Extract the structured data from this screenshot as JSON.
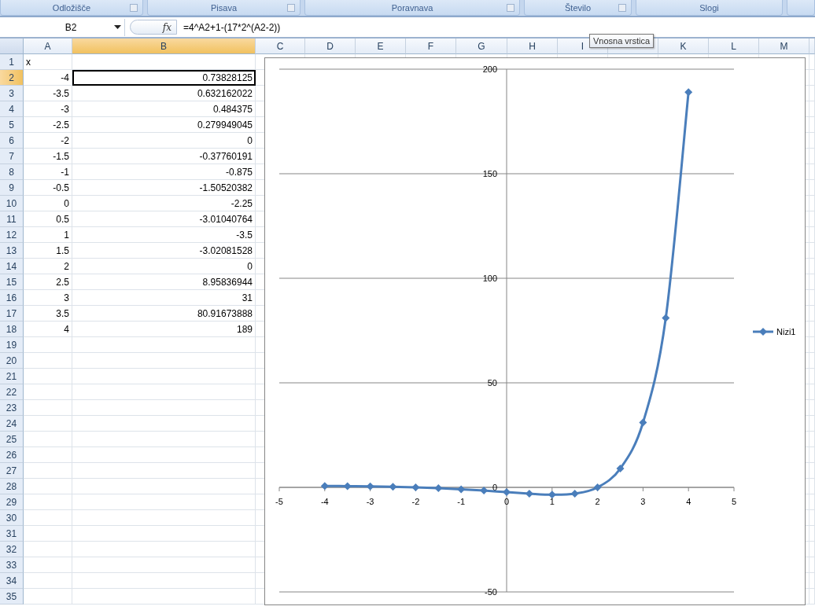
{
  "ribbon_groups": [
    {
      "label": "Odložišče",
      "launcher": true
    },
    {
      "label": "Pisava",
      "launcher": true
    },
    {
      "label": "Poravnava",
      "launcher": true
    },
    {
      "label": "Število",
      "launcher": true
    },
    {
      "label": "Slogi",
      "launcher": false
    }
  ],
  "formula_bar": {
    "name_box": "B2",
    "function_button": "fx",
    "formula": "=4^A2+1-(17*2^(A2-2))"
  },
  "tooltip": "Vnosna vrstica",
  "columns": [
    {
      "label": "A"
    },
    {
      "label": "B"
    },
    {
      "label": "C"
    },
    {
      "label": "D"
    },
    {
      "label": "E"
    },
    {
      "label": "F"
    },
    {
      "label": "G"
    },
    {
      "label": "H"
    },
    {
      "label": "I"
    },
    {},
    {
      "label": "K"
    },
    {
      "label": "L"
    },
    {
      "label": "M"
    }
  ],
  "rows": [
    {
      "header": "1",
      "cells": [
        {
          "text": "x",
          "kind": "text",
          "selected": false
        },
        {
          "selected": false
        }
      ]
    },
    {
      "header": "2",
      "cells": [
        {
          "text": "-4",
          "kind": "number",
          "selected": false
        },
        {
          "text": "0.73828125",
          "kind": "number",
          "selected": true
        }
      ]
    },
    {
      "header": "3",
      "cells": [
        {
          "text": "-3.5",
          "kind": "number",
          "selected": false
        },
        {
          "text": "0.632162022",
          "kind": "number",
          "selected": false
        }
      ]
    },
    {
      "header": "4",
      "cells": [
        {
          "text": "-3",
          "kind": "number",
          "selected": false
        },
        {
          "text": "0.484375",
          "kind": "number",
          "selected": false
        }
      ]
    },
    {
      "header": "5",
      "cells": [
        {
          "text": "-2.5",
          "kind": "number",
          "selected": false
        },
        {
          "text": "0.279949045",
          "kind": "number",
          "selected": false
        }
      ]
    },
    {
      "header": "6",
      "cells": [
        {
          "text": "-2",
          "kind": "number",
          "selected": false
        },
        {
          "text": "0",
          "kind": "number",
          "selected": false
        }
      ]
    },
    {
      "header": "7",
      "cells": [
        {
          "text": "-1.5",
          "kind": "number",
          "selected": false
        },
        {
          "text": "-0.37760191",
          "kind": "number",
          "selected": false
        }
      ]
    },
    {
      "header": "8",
      "cells": [
        {
          "text": "-1",
          "kind": "number",
          "selected": false
        },
        {
          "text": "-0.875",
          "kind": "number",
          "selected": false
        }
      ]
    },
    {
      "header": "9",
      "cells": [
        {
          "text": "-0.5",
          "kind": "number",
          "selected": false
        },
        {
          "text": "-1.50520382",
          "kind": "number",
          "selected": false
        }
      ]
    },
    {
      "header": "10",
      "cells": [
        {
          "text": "0",
          "kind": "number",
          "selected": false
        },
        {
          "text": "-2.25",
          "kind": "number",
          "selected": false
        }
      ]
    },
    {
      "header": "11",
      "cells": [
        {
          "text": "0.5",
          "kind": "number",
          "selected": false
        },
        {
          "text": "-3.01040764",
          "kind": "number",
          "selected": false
        }
      ]
    },
    {
      "header": "12",
      "cells": [
        {
          "text": "1",
          "kind": "number",
          "selected": false
        },
        {
          "text": "-3.5",
          "kind": "number",
          "selected": false
        }
      ]
    },
    {
      "header": "13",
      "cells": [
        {
          "text": "1.5",
          "kind": "number",
          "selected": false
        },
        {
          "text": "-3.02081528",
          "kind": "number",
          "selected": false
        }
      ]
    },
    {
      "header": "14",
      "cells": [
        {
          "text": "2",
          "kind": "number",
          "selected": false
        },
        {
          "text": "0",
          "kind": "number",
          "selected": false
        }
      ]
    },
    {
      "header": "15",
      "cells": [
        {
          "text": "2.5",
          "kind": "number",
          "selected": false
        },
        {
          "text": "8.95836944",
          "kind": "number",
          "selected": false
        }
      ]
    },
    {
      "header": "16",
      "cells": [
        {
          "text": "3",
          "kind": "number",
          "selected": false
        },
        {
          "text": "31",
          "kind": "number",
          "selected": false
        }
      ]
    },
    {
      "header": "17",
      "cells": [
        {
          "text": "3.5",
          "kind": "number",
          "selected": false
        },
        {
          "text": "80.91673888",
          "kind": "number",
          "selected": false
        }
      ]
    },
    {
      "header": "18",
      "cells": [
        {
          "text": "4",
          "kind": "number",
          "selected": false
        },
        {
          "text": "189",
          "kind": "number",
          "selected": false
        }
      ]
    },
    {
      "header": "19"
    },
    {
      "header": "20"
    },
    {
      "header": "21"
    },
    {
      "header": "22"
    },
    {
      "header": "23"
    },
    {
      "header": "24"
    },
    {
      "header": "25"
    },
    {
      "header": "26"
    },
    {
      "header": "27"
    },
    {
      "header": "28"
    },
    {
      "header": "29"
    },
    {
      "header": "30"
    },
    {
      "header": "31"
    },
    {
      "header": "32"
    },
    {
      "header": "33"
    },
    {
      "header": "34"
    },
    {
      "header": "35"
    }
  ],
  "chart": {
    "chart_data": {
      "type": "line",
      "x": [
        -4,
        -3.5,
        -3,
        -2.5,
        -2,
        -1.5,
        -1,
        -0.5,
        0,
        0.5,
        1,
        1.5,
        2,
        2.5,
        3,
        3.5,
        4
      ],
      "series": [
        {
          "name": "Nizi1",
          "color": "#4a7ebb",
          "marker": "diamond",
          "values": [
            0.7,
            0.6,
            0.5,
            0.3,
            0,
            -0.4,
            -0.9,
            -1.5,
            -2.3,
            -3,
            -3.5,
            -3,
            0,
            9,
            31,
            81,
            189
          ]
        }
      ],
      "grid": true,
      "xlim": [
        -5,
        5
      ],
      "ylim": [
        -50,
        200
      ],
      "xticks": [
        -5,
        -4,
        -3,
        -2,
        -1,
        0,
        1,
        2,
        3,
        4,
        5
      ],
      "yticks": [
        -50,
        0,
        50,
        100,
        150,
        200
      ]
    }
  }
}
